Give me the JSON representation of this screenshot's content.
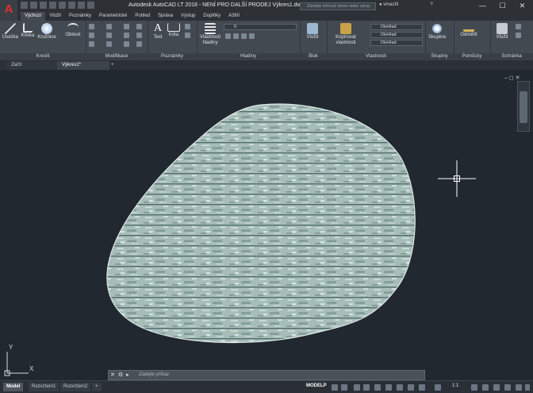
{
  "app": {
    "logo_letter": "A",
    "title": "Autodesk AutoCAD LT 2018 - NENÍ PRO DALŠÍ PRODEJ    Výkres1.dwg",
    "search_placeholder": "Zadejte klíčové slovo nebo výraz",
    "user": "vmachl",
    "window_controls": [
      "—",
      "☐",
      "✕"
    ]
  },
  "ribbon_tabs": [
    "Výchozí",
    "Vložit",
    "Poznámky",
    "Parametrické",
    "Pohled",
    "Správa",
    "Výstup",
    "Doplňky",
    "A360"
  ],
  "panels": {
    "draw": {
      "label": "Kreslit",
      "buttons": [
        "Úsečka",
        "Křivka",
        "Kružnice",
        "Oblouk"
      ]
    },
    "modify": {
      "label": "Modifikace"
    },
    "annotation": {
      "label": "Poznámky",
      "buttons": [
        "Text",
        "Kóta"
      ]
    },
    "layers": {
      "label": "Hladiny",
      "button": "Vlastnosti hladiny",
      "layer_value": "0"
    },
    "block": {
      "label": "Blok",
      "button": "Vložit"
    },
    "properties": {
      "label": "Vlastnosti",
      "button": "Kopírovat vlastnosti",
      "values": [
        "DleHlad",
        "DleHlad",
        "DleHlad"
      ]
    },
    "groups": {
      "label": "Skupiny",
      "button": "Skupina"
    },
    "utilities": {
      "label": "Pomůcky",
      "button": "Odměřit"
    },
    "clipboard": {
      "label": "Schránka",
      "button": "Vložit"
    }
  },
  "doc_tabs": [
    "Začít",
    "Výkres1*"
  ],
  "viewport_controls": "–  ◻  ✕",
  "ucs": {
    "x": "X",
    "y": "Y"
  },
  "command": {
    "placeholder": "Zadejte příkaz"
  },
  "layout_tabs": [
    "Model",
    "Rozvržení1",
    "Rozvržení2"
  ],
  "status": {
    "modelspace": "MODELP",
    "scale": "1:1"
  },
  "colors": {
    "background": "#212830",
    "hatch": "#a9c0bb",
    "crosshair": "#ffffff"
  }
}
